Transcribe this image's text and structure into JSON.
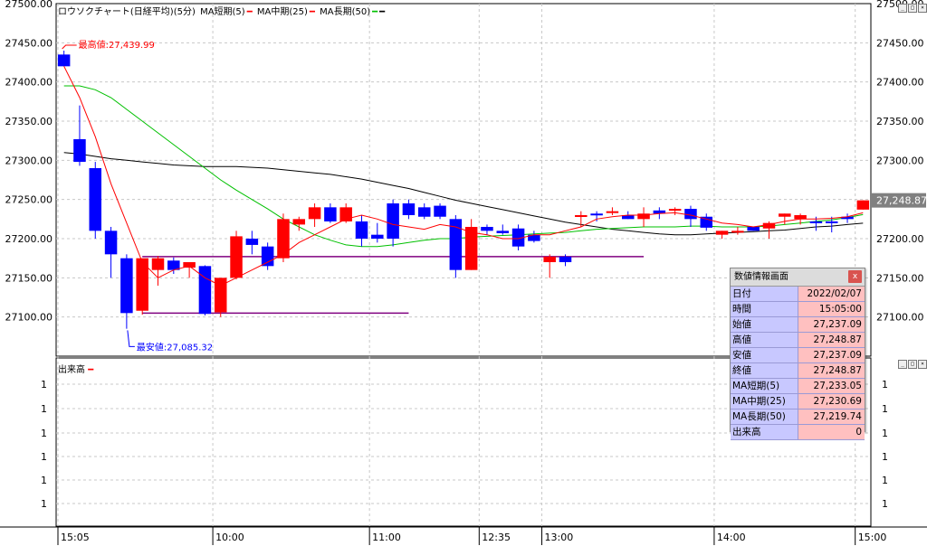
{
  "legend": {
    "main": "ロウソクチャート(日経平均)(5分)",
    "ma_short": "MA短期(5)",
    "ma_mid": "MA中期(25)",
    "ma_long": "MA長期(50)"
  },
  "volume_legend": "出来高",
  "colors": {
    "up": "#ff0000",
    "down": "#0000ff",
    "ma_short": "#ff0000",
    "ma_mid": "#00c000",
    "ma_long": "#000000",
    "support": "#800080",
    "label_box": "#808080"
  },
  "info_panel": {
    "title": "数値情報画面",
    "close": "x",
    "rows": [
      {
        "label": "日付",
        "value": "2022/02/07"
      },
      {
        "label": "時間",
        "value": "15:05:00"
      },
      {
        "label": "始値",
        "value": "27,237.09"
      },
      {
        "label": "高値",
        "value": "27,248.87"
      },
      {
        "label": "安値",
        "value": "27,237.09"
      },
      {
        "label": "終値",
        "value": "27,248.87"
      },
      {
        "label": "MA短期(5)",
        "value": "27,233.05"
      },
      {
        "label": "MA中期(25)",
        "value": "27,230.69"
      },
      {
        "label": "MA長期(50)",
        "value": "27,219.74"
      },
      {
        "label": "出来高",
        "value": "0"
      }
    ]
  },
  "chart_data": {
    "type": "candlestick",
    "y_ticks": [
      "27500.00",
      "27450.00",
      "27400.00",
      "27350.00",
      "27300.00",
      "27250.00",
      "27200.00",
      "27150.00",
      "27100.00"
    ],
    "ylim": [
      27050,
      27500
    ],
    "x_labels": [
      "15:05",
      "10:00",
      "11:00",
      "12:35",
      "13:00",
      "14:00",
      "15:00"
    ],
    "x_label_index": [
      0,
      10,
      20,
      27,
      31,
      42,
      51
    ],
    "current_price": "27,248.87",
    "current_value": 27248.87,
    "annotations": [
      {
        "text": "最高値:27,439.99",
        "index": 0,
        "value": 27439.99,
        "kind": "high"
      },
      {
        "text": "最安値:27,085.32",
        "index": 4,
        "value": 27085.32,
        "kind": "low"
      }
    ],
    "support_lines": [
      {
        "value": 27177,
        "from": 5,
        "to": 37
      },
      {
        "value": 27105,
        "from": 5,
        "to": 22
      }
    ],
    "candles": [
      {
        "o": 27435,
        "h": 27440,
        "l": 27420,
        "c": 27420
      },
      {
        "o": 27327,
        "h": 27370,
        "l": 27293,
        "c": 27298
      },
      {
        "o": 27290,
        "h": 27298,
        "l": 27200,
        "c": 27210
      },
      {
        "o": 27210,
        "h": 27215,
        "l": 27150,
        "c": 27180
      },
      {
        "o": 27175,
        "h": 27180,
        "l": 27085,
        "c": 27105
      },
      {
        "o": 27108,
        "h": 27113,
        "l": 27103,
        "c": 27175
      },
      {
        "o": 27160,
        "h": 27178,
        "l": 27140,
        "c": 27175
      },
      {
        "o": 27172,
        "h": 27176,
        "l": 27155,
        "c": 27160
      },
      {
        "o": 27163,
        "h": 27170,
        "l": 27150,
        "c": 27170
      },
      {
        "o": 27165,
        "h": 27166,
        "l": 27102,
        "c": 27104
      },
      {
        "o": 27106,
        "h": 27110,
        "l": 27100,
        "c": 27150
      },
      {
        "o": 27150,
        "h": 27210,
        "l": 27148,
        "c": 27203
      },
      {
        "o": 27200,
        "h": 27210,
        "l": 27180,
        "c": 27192
      },
      {
        "o": 27190,
        "h": 27195,
        "l": 27160,
        "c": 27165
      },
      {
        "o": 27175,
        "h": 27232,
        "l": 27170,
        "c": 27225
      },
      {
        "o": 27218,
        "h": 27228,
        "l": 27210,
        "c": 27225
      },
      {
        "o": 27225,
        "h": 27245,
        "l": 27215,
        "c": 27240
      },
      {
        "o": 27240,
        "h": 27245,
        "l": 27220,
        "c": 27222
      },
      {
        "o": 27222,
        "h": 27245,
        "l": 27220,
        "c": 27240
      },
      {
        "o": 27222,
        "h": 27230,
        "l": 27190,
        "c": 27200
      },
      {
        "o": 27205,
        "h": 27220,
        "l": 27195,
        "c": 27200
      },
      {
        "o": 27245,
        "h": 27250,
        "l": 27190,
        "c": 27200
      },
      {
        "o": 27245,
        "h": 27250,
        "l": 27225,
        "c": 27230
      },
      {
        "o": 27240,
        "h": 27245,
        "l": 27225,
        "c": 27228
      },
      {
        "o": 27242,
        "h": 27245,
        "l": 27225,
        "c": 27228
      },
      {
        "o": 27225,
        "h": 27230,
        "l": 27150,
        "c": 27160
      },
      {
        "o": 27160,
        "h": 27225,
        "l": 27160,
        "c": 27215
      },
      {
        "o": 27215,
        "h": 27218,
        "l": 27205,
        "c": 27210
      },
      {
        "o": 27210,
        "h": 27218,
        "l": 27205,
        "c": 27207
      },
      {
        "o": 27213,
        "h": 27218,
        "l": 27185,
        "c": 27190
      },
      {
        "o": 27205,
        "h": 27210,
        "l": 27195,
        "c": 27197
      },
      {
        "o": 27170,
        "h": 27180,
        "l": 27150,
        "c": 27177
      },
      {
        "o": 27177,
        "h": 27180,
        "l": 27165,
        "c": 27170
      },
      {
        "o": 27230,
        "h": 27235,
        "l": 27215,
        "c": 27230
      },
      {
        "o": 27232,
        "h": 27235,
        "l": 27222,
        "c": 27230
      },
      {
        "o": 27234,
        "h": 27240,
        "l": 27230,
        "c": 27235
      },
      {
        "o": 27230,
        "h": 27235,
        "l": 27225,
        "c": 27225
      },
      {
        "o": 27225,
        "h": 27240,
        "l": 27215,
        "c": 27232
      },
      {
        "o": 27236,
        "h": 27240,
        "l": 27225,
        "c": 27232
      },
      {
        "o": 27236,
        "h": 27240,
        "l": 27230,
        "c": 27238
      },
      {
        "o": 27238,
        "h": 27242,
        "l": 27215,
        "c": 27225
      },
      {
        "o": 27228,
        "h": 27232,
        "l": 27210,
        "c": 27214
      },
      {
        "o": 27205,
        "h": 27210,
        "l": 27200,
        "c": 27210
      },
      {
        "o": 27210,
        "h": 27215,
        "l": 27205,
        "c": 27210
      },
      {
        "o": 27215,
        "h": 27215,
        "l": 27210,
        "c": 27210
      },
      {
        "o": 27213,
        "h": 27222,
        "l": 27200,
        "c": 27220
      },
      {
        "o": 27228,
        "h": 27232,
        "l": 27218,
        "c": 27232
      },
      {
        "o": 27225,
        "h": 27232,
        "l": 27218,
        "c": 27230
      },
      {
        "o": 27222,
        "h": 27228,
        "l": 27210,
        "c": 27220
      },
      {
        "o": 27222,
        "h": 27228,
        "l": 27208,
        "c": 27220
      },
      {
        "o": 27228,
        "h": 27232,
        "l": 27220,
        "c": 27225
      },
      {
        "o": 27237.09,
        "h": 27248.87,
        "l": 27237.09,
        "c": 27248.87
      }
    ],
    "ma_short": [
      27420,
      27380,
      27330,
      27270,
      27220,
      27170,
      27150,
      27160,
      27165,
      27150,
      27140,
      27150,
      27160,
      27170,
      27180,
      27195,
      27205,
      27215,
      27225,
      27230,
      27225,
      27218,
      27215,
      27212,
      27218,
      27215,
      27208,
      27205,
      27200,
      27200,
      27205,
      27205,
      27210,
      27215,
      27225,
      27228,
      27230,
      27230,
      27232,
      27233,
      27230,
      27225,
      27220,
      27218,
      27215,
      27218,
      27222,
      27225,
      27225,
      27226,
      27228,
      27233.05
    ],
    "ma_mid": [
      27395,
      27395,
      27390,
      27380,
      27365,
      27350,
      27335,
      27320,
      27305,
      27290,
      27275,
      27262,
      27250,
      27238,
      27225,
      27215,
      27205,
      27198,
      27192,
      27190,
      27190,
      27192,
      27195,
      27198,
      27200,
      27200,
      27202,
      27203,
      27204,
      27205,
      27206,
      27207,
      27208,
      27210,
      27212,
      27213,
      27214,
      27215,
      27215,
      27215,
      27216,
      27216,
      27215,
      27215,
      27215,
      27216,
      27218,
      27220,
      27222,
      27224,
      27227,
      27230.69
    ],
    "ma_long": [
      27310,
      27308,
      27305,
      27302,
      27300,
      27298,
      27296,
      27294,
      27293,
      27292,
      27292,
      27292,
      27291,
      27290,
      27288,
      27286,
      27284,
      27282,
      27279,
      27276,
      27272,
      27268,
      27264,
      27259,
      27254,
      27249,
      27245,
      27241,
      27237,
      27233,
      27229,
      27225,
      27221,
      27218,
      27215,
      27212,
      27210,
      27208,
      27206,
      27205,
      27205,
      27206,
      27207,
      27208,
      27209,
      27210,
      27211,
      27213,
      27215,
      27216,
      27218,
      27219.74
    ]
  }
}
